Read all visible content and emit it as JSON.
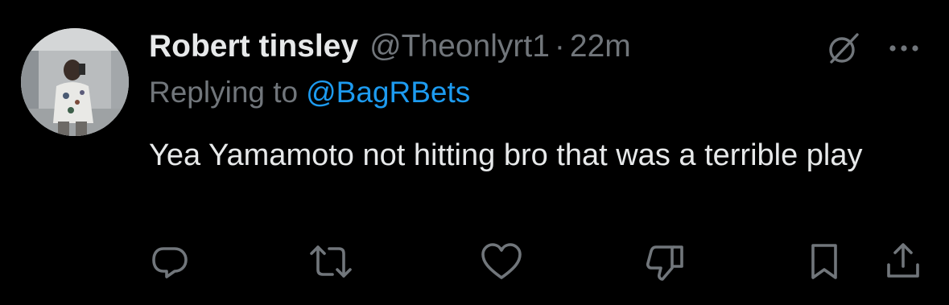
{
  "tweet": {
    "display_name": "Robert tinsley",
    "handle": "@Theonlyrt1",
    "separator": "·",
    "time": "22m",
    "reply_prefix": "Replying to",
    "reply_handle": "@BagRBets",
    "text": "Yea Yamamoto not hitting bro that was a terrible play"
  },
  "icons": {
    "avatar": "user-avatar",
    "grok": "grok-icon",
    "more": "more-icon",
    "reply": "reply-icon",
    "repost": "repost-icon",
    "like": "heart-icon",
    "dislike": "dislike-icon",
    "bookmark": "bookmark-icon",
    "share": "share-icon"
  },
  "colors": {
    "background": "#000000",
    "primary_text": "#e7e9ea",
    "secondary_text": "#71767b",
    "link": "#1d9bf0"
  }
}
